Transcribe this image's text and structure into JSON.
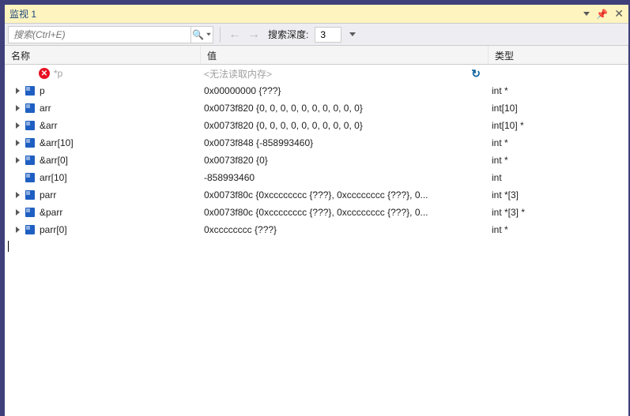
{
  "title": "监视 1",
  "toolbar": {
    "search_placeholder": "搜索(Ctrl+E)",
    "depth_label": "搜索深度:",
    "depth_value": "3"
  },
  "headers": {
    "name": "名称",
    "value": "值",
    "type": "类型"
  },
  "rows": [
    {
      "expandable": false,
      "icon": "error",
      "name": "*p",
      "name_disabled": true,
      "value": "<无法读取内存>",
      "value_disabled": true,
      "type": "",
      "refresh": true
    },
    {
      "expandable": true,
      "icon": "cube",
      "name": "p",
      "value": "0x00000000 {???}",
      "type": "int *"
    },
    {
      "expandable": true,
      "icon": "cube",
      "name": "arr",
      "value": "0x0073f820 {0, 0, 0, 0, 0, 0, 0, 0, 0, 0}",
      "type": "int[10]"
    },
    {
      "expandable": true,
      "icon": "cube",
      "name": "&arr",
      "value": "0x0073f820 {0, 0, 0, 0, 0, 0, 0, 0, 0, 0}",
      "type": "int[10] *"
    },
    {
      "expandable": true,
      "icon": "cube",
      "name": "&arr[10]",
      "value": "0x0073f848 {-858993460}",
      "type": "int *"
    },
    {
      "expandable": true,
      "icon": "cube",
      "name": "&arr[0]",
      "value": "0x0073f820 {0}",
      "type": "int *"
    },
    {
      "expandable": false,
      "icon": "cube",
      "name": "arr[10]",
      "value": "-858993460",
      "type": "int"
    },
    {
      "expandable": true,
      "icon": "cube",
      "name": "parr",
      "value": "0x0073f80c {0xcccccccc {???}, 0xcccccccc {???}, 0...",
      "type": "int *[3]"
    },
    {
      "expandable": true,
      "icon": "cube",
      "name": "&parr",
      "value": "0x0073f80c {0xcccccccc {???}, 0xcccccccc {???}, 0...",
      "type": "int *[3] *"
    },
    {
      "expandable": true,
      "icon": "cube",
      "name": "parr[0]",
      "value": "0xcccccccc {???}",
      "type": "int *"
    }
  ]
}
